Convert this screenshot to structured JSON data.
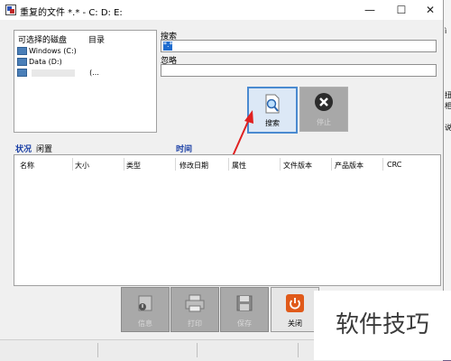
{
  "window": {
    "title": "重复的文件 *.* - C: D: E:"
  },
  "drives": {
    "headers": [
      "可选择的磁盘",
      "目录"
    ],
    "items": [
      {
        "label": "Windows (C:)"
      },
      {
        "label": "Data (D:)"
      },
      {
        "label": "\\u2002 (...",
        "dir": "(..."
      }
    ]
  },
  "search": {
    "label": "搜索",
    "value": "*.*"
  },
  "ignore": {
    "label": "忽略",
    "value": ""
  },
  "buttons": {
    "search": "搜索",
    "stop": "停止"
  },
  "status": {
    "label": "状况",
    "value": "闲置",
    "time_label": "时间"
  },
  "columns": [
    "名称",
    "大小",
    "类型",
    "修改日期",
    "属性",
    "文件版本",
    "产品版本",
    "CRC"
  ],
  "bottom_buttons": [
    "信息",
    "打印",
    "保存",
    "关闭"
  ],
  "watermark": "软件技巧",
  "right_strip": [
    "ì",
    "扭",
    "相",
    "说"
  ],
  "colors": {
    "accent_blue": "#1a3fa5",
    "selection": "#1e6ccf",
    "close_icon": "#e05a1a"
  }
}
